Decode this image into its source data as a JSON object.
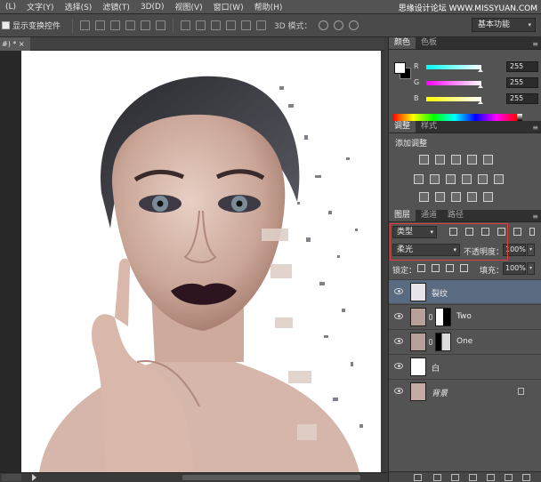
{
  "menu": {
    "items": [
      "(L)",
      "文字(Y)",
      "选择(S)",
      "滤镜(T)",
      "3D(D)",
      "视图(V)",
      "窗口(W)",
      "帮助(H)"
    ],
    "watermark": "思缘设计论坛 WWW.MISSYUAN.COM"
  },
  "options": {
    "show_transform_label": "显示变换控件",
    "mode_3d_label": "3D 模式：",
    "workspace": "基本功能"
  },
  "document": {
    "tab_label": "#) * ×"
  },
  "panels": {
    "color_tabs": [
      "颜色",
      "色板"
    ],
    "color": {
      "channels": [
        {
          "label": "R",
          "value": "255",
          "gradient": [
            "#00ffff",
            "#ffffff"
          ]
        },
        {
          "label": "G",
          "value": "255",
          "gradient": [
            "#ff00ff",
            "#ffffff"
          ]
        },
        {
          "label": "B",
          "value": "255",
          "gradient": [
            "#ffff00",
            "#ffffff"
          ]
        }
      ]
    },
    "adjust_tabs": [
      "调整",
      "样式"
    ],
    "adjust_title": "添加调整",
    "layers_tabs": [
      "图层",
      "通道",
      "路径"
    ],
    "filter_kind": "类型",
    "blend_mode": "柔光",
    "opacity_label": "不透明度：",
    "opacity_value": "100%",
    "lock_label": "锁定：",
    "fill_label": "填充：",
    "fill_value": "100%",
    "layers": [
      {
        "name": "裂纹",
        "selected": true,
        "italic": false,
        "has_mask": false,
        "locked": false
      },
      {
        "name": "Two",
        "selected": false,
        "italic": false,
        "has_mask": true,
        "locked": false
      },
      {
        "name": "One",
        "selected": false,
        "italic": false,
        "has_mask": true,
        "locked": false
      },
      {
        "name": "白",
        "selected": false,
        "italic": false,
        "has_mask": false,
        "locked": false
      },
      {
        "name": "背景",
        "selected": false,
        "italic": true,
        "has_mask": false,
        "locked": true
      }
    ]
  }
}
